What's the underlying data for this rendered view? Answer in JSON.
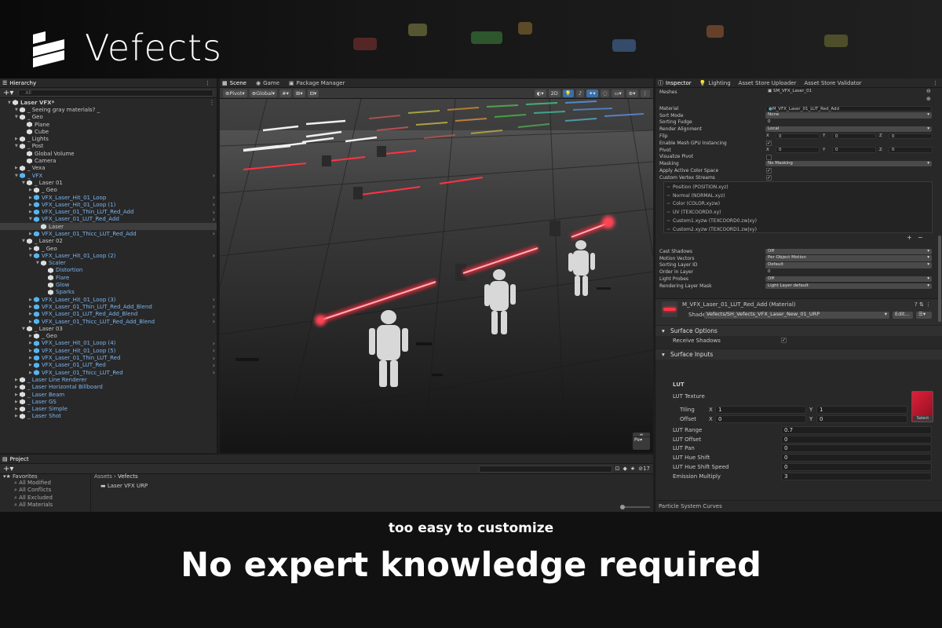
{
  "brand": {
    "name": "Vefects"
  },
  "hierarchy": {
    "tab": "Hierarchy",
    "search_placeholder": "All",
    "rows": [
      {
        "label": "Laser VFX*",
        "depth": 0,
        "bold": true,
        "blue": false,
        "icon": "unity",
        "open": true
      },
      {
        "label": "_ Seeing gray materials? _",
        "depth": 1,
        "blue": false,
        "icon": "cube",
        "open": true
      },
      {
        "label": "_ Geo",
        "depth": 1,
        "blue": false,
        "icon": "cube",
        "open": true
      },
      {
        "label": "Plane",
        "depth": 2,
        "blue": false,
        "icon": "cube"
      },
      {
        "label": "Cube",
        "depth": 2,
        "blue": false,
        "icon": "cube"
      },
      {
        "label": "_ Lights",
        "depth": 1,
        "blue": false,
        "icon": "cube",
        "open": false
      },
      {
        "label": "_ Post",
        "depth": 1,
        "blue": false,
        "icon": "cube",
        "open": true
      },
      {
        "label": "Global Volume",
        "depth": 2,
        "blue": false,
        "icon": "cube"
      },
      {
        "label": "Camera",
        "depth": 2,
        "blue": false,
        "icon": "cube"
      },
      {
        "label": "_ Vexa",
        "depth": 1,
        "blue": false,
        "icon": "cube",
        "open": false
      },
      {
        "label": "_ VFX",
        "depth": 1,
        "blue": true,
        "icon": "blue",
        "open": true,
        "arrow": true
      },
      {
        "label": "_ Laser 01",
        "depth": 2,
        "blue": false,
        "icon": "cube",
        "open": true
      },
      {
        "label": "_ Geo",
        "depth": 3,
        "blue": false,
        "icon": "cube",
        "open": false
      },
      {
        "label": "VFX_Laser_Hit_01_Loop",
        "depth": 3,
        "blue": true,
        "icon": "blue",
        "open": false,
        "arrow": true
      },
      {
        "label": "VFX_Laser_Hit_01_Loop (1)",
        "depth": 3,
        "blue": true,
        "icon": "blue",
        "open": false,
        "arrow": true
      },
      {
        "label": "VFX_Laser_01_Thin_LUT_Red_Add",
        "depth": 3,
        "blue": true,
        "icon": "blue",
        "open": false,
        "arrow": true
      },
      {
        "label": "VFX_Laser_01_LUT_Red_Add",
        "depth": 3,
        "blue": true,
        "icon": "blue",
        "open": true,
        "arrow": true
      },
      {
        "label": "Laser",
        "depth": 4,
        "blue": false,
        "icon": "cube",
        "selected": true
      },
      {
        "label": "VFX_Laser_01_Thicc_LUT_Red_Add",
        "depth": 3,
        "blue": true,
        "icon": "blue",
        "open": false,
        "arrow": true
      },
      {
        "label": "_ Laser 02",
        "depth": 2,
        "blue": false,
        "icon": "cube",
        "open": true
      },
      {
        "label": "_ Geo",
        "depth": 3,
        "blue": false,
        "icon": "cube",
        "open": false
      },
      {
        "label": "VFX_Laser_Hit_01_Loop (2)",
        "depth": 3,
        "blue": true,
        "icon": "blue",
        "open": true,
        "arrow": true
      },
      {
        "label": "Scaler",
        "depth": 4,
        "blue": true,
        "icon": "cube",
        "open": true
      },
      {
        "label": "Distortion",
        "depth": 5,
        "blue": true,
        "icon": "cube"
      },
      {
        "label": "Flare",
        "depth": 5,
        "blue": true,
        "icon": "cube"
      },
      {
        "label": "Glow",
        "depth": 5,
        "blue": true,
        "icon": "cube"
      },
      {
        "label": "Sparks",
        "depth": 5,
        "blue": true,
        "icon": "cube"
      },
      {
        "label": "VFX_Laser_Hit_01_Loop (3)",
        "depth": 3,
        "blue": true,
        "icon": "blue",
        "open": false,
        "arrow": true
      },
      {
        "label": "VFX_Laser_01_Thin_LUT_Red_Add_Blend",
        "depth": 3,
        "blue": true,
        "icon": "blue",
        "open": false,
        "arrow": true
      },
      {
        "label": "VFX_Laser_01_LUT_Red_Add_Blend",
        "depth": 3,
        "blue": true,
        "icon": "blue",
        "open": false,
        "arrow": true
      },
      {
        "label": "VFX_Laser_01_Thicc_LUT_Red_Add_Blend",
        "depth": 3,
        "blue": true,
        "icon": "blue",
        "open": false,
        "arrow": true
      },
      {
        "label": "_ Laser 03",
        "depth": 2,
        "blue": false,
        "icon": "cube",
        "open": true
      },
      {
        "label": "_ Geo",
        "depth": 3,
        "blue": false,
        "icon": "cube",
        "open": false
      },
      {
        "label": "VFX_Laser_Hit_01_Loop (4)",
        "depth": 3,
        "blue": true,
        "icon": "blue",
        "open": false,
        "arrow": true
      },
      {
        "label": "VFX_Laser_Hit_01_Loop (5)",
        "depth": 3,
        "blue": true,
        "icon": "blue",
        "open": false,
        "arrow": true
      },
      {
        "label": "VFX_Laser_01_Thin_LUT_Red",
        "depth": 3,
        "blue": true,
        "icon": "blue",
        "open": false,
        "arrow": true
      },
      {
        "label": "VFX_Laser_01_LUT_Red",
        "depth": 3,
        "blue": true,
        "icon": "blue",
        "open": false,
        "arrow": true
      },
      {
        "label": "VFX_Laser_01_Thicc_LUT_Red",
        "depth": 3,
        "blue": true,
        "icon": "blue",
        "open": false,
        "arrow": true
      },
      {
        "label": "_ Laser Line Renderer",
        "depth": 1,
        "blue": true,
        "icon": "cube",
        "open": false
      },
      {
        "label": "_ Laser Horizontal Billboard",
        "depth": 1,
        "blue": true,
        "icon": "cube",
        "open": false
      },
      {
        "label": "_ Laser Beam",
        "depth": 1,
        "blue": true,
        "icon": "cube",
        "open": false
      },
      {
        "label": "_ Laser GS",
        "depth": 1,
        "blue": true,
        "icon": "cube",
        "open": false
      },
      {
        "label": "_ Laser Simple",
        "depth": 1,
        "blue": true,
        "icon": "cube",
        "open": false
      },
      {
        "label": "_ Laser Shot",
        "depth": 1,
        "blue": true,
        "icon": "cube",
        "open": false
      }
    ]
  },
  "scene": {
    "tabs": [
      "Scene",
      "Game",
      "Package Manager"
    ],
    "pivot": "Pivot",
    "global": "Global",
    "two_d": "2D",
    "camera_btn": "Pe"
  },
  "inspector": {
    "tabs": [
      "Inspector",
      "Lighting",
      "Asset Store Uploader",
      "Asset Store Validator"
    ],
    "meshes_label": "Meshes",
    "meshes_value": "SM_VFX_Laser_01",
    "props": [
      {
        "label": "Material",
        "value": "M_VFX_Laser_01_LUT_Red_Add",
        "kind": "obj"
      },
      {
        "label": "Sort Mode",
        "value": "None",
        "kind": "drop"
      },
      {
        "label": "Sorting Fudge",
        "value": "0",
        "kind": "text"
      },
      {
        "label": "Render Alignment",
        "value": "Local",
        "kind": "drop"
      },
      {
        "label": "Flip",
        "value": "",
        "kind": "xyz",
        "x": "0",
        "y": "0",
        "z": "0"
      },
      {
        "label": "Enable Mesh GPU Instancing",
        "value": "✓",
        "kind": "check"
      },
      {
        "label": "Pivot",
        "value": "",
        "kind": "xyz",
        "x": "0",
        "y": "0",
        "z": "0"
      },
      {
        "label": "Visualize Pivot",
        "value": "",
        "kind": "check"
      },
      {
        "label": "Masking",
        "value": "No Masking",
        "kind": "drop"
      },
      {
        "label": "Apply Active Color Space",
        "value": "✓",
        "kind": "check"
      },
      {
        "label": "Custom Vertex Streams",
        "value": "✓",
        "kind": "check"
      }
    ],
    "streams": [
      "Position (POSITION.xyz)",
      "Normal (NORMAL.xyz)",
      "Color (COLOR.xyzw)",
      "UV (TEXCOORD0.xy)",
      "Custom1.xyzw (TEXCOORD0.zw|xy)",
      "Custom2.xyzw (TEXCOORD1.zw|xy)"
    ],
    "props2": [
      {
        "label": "Cast Shadows",
        "value": "Off"
      },
      {
        "label": "Motion Vectors",
        "value": "Per Object Motion"
      },
      {
        "label": "Sorting Layer ID",
        "value": "Default"
      },
      {
        "label": "Order in Layer",
        "value": "0",
        "kind": "text"
      },
      {
        "label": "Light Probes",
        "value": "Off"
      },
      {
        "label": "Rendering Layer Mask",
        "value": "Light Layer default"
      }
    ],
    "material_name": "M_VFX_Laser_01_LUT_Red_Add (Material)",
    "shader_label": "Shader",
    "shader_value": "Vefects/SH_Vefects_VFX_Laser_New_01_URP",
    "edit_label": "Edit...",
    "surface_options": "Surface Options",
    "receive_shadows": "Receive Shadows",
    "surface_inputs": "Surface Inputs",
    "lut_header": "LUT",
    "lut_texture": "LUT Texture",
    "tiling": "Tiling",
    "tiling_x": "1",
    "tiling_y": "1",
    "offset": "Offset",
    "offset_x": "0",
    "offset_y": "0",
    "select": "Select",
    "lut_props": [
      {
        "label": "LUT Range",
        "value": "0.7"
      },
      {
        "label": "LUT Offset",
        "value": "0"
      },
      {
        "label": "LUT Pan",
        "value": "0"
      },
      {
        "label": "LUT Hue Shift",
        "value": "0"
      },
      {
        "label": "LUT Hue Shift Speed",
        "value": "0"
      },
      {
        "label": "Emission Multiply",
        "value": "3"
      }
    ],
    "curves": "Particle System Curves"
  },
  "project": {
    "tab": "Project",
    "favorites": "Favorites",
    "fav_items": [
      "All Modified",
      "All Conflicts",
      "All Excluded",
      "All Materials"
    ],
    "crumb_root": "Assets",
    "crumb_leaf": "Vefects",
    "folder": "Laser VFX URP",
    "hidden_count": "17"
  },
  "caption": {
    "sub": "too easy to customize",
    "headline": "No expert knowledge required"
  },
  "colors": {
    "laser": "#ff2a3c",
    "blue": "#7cb4f0"
  }
}
